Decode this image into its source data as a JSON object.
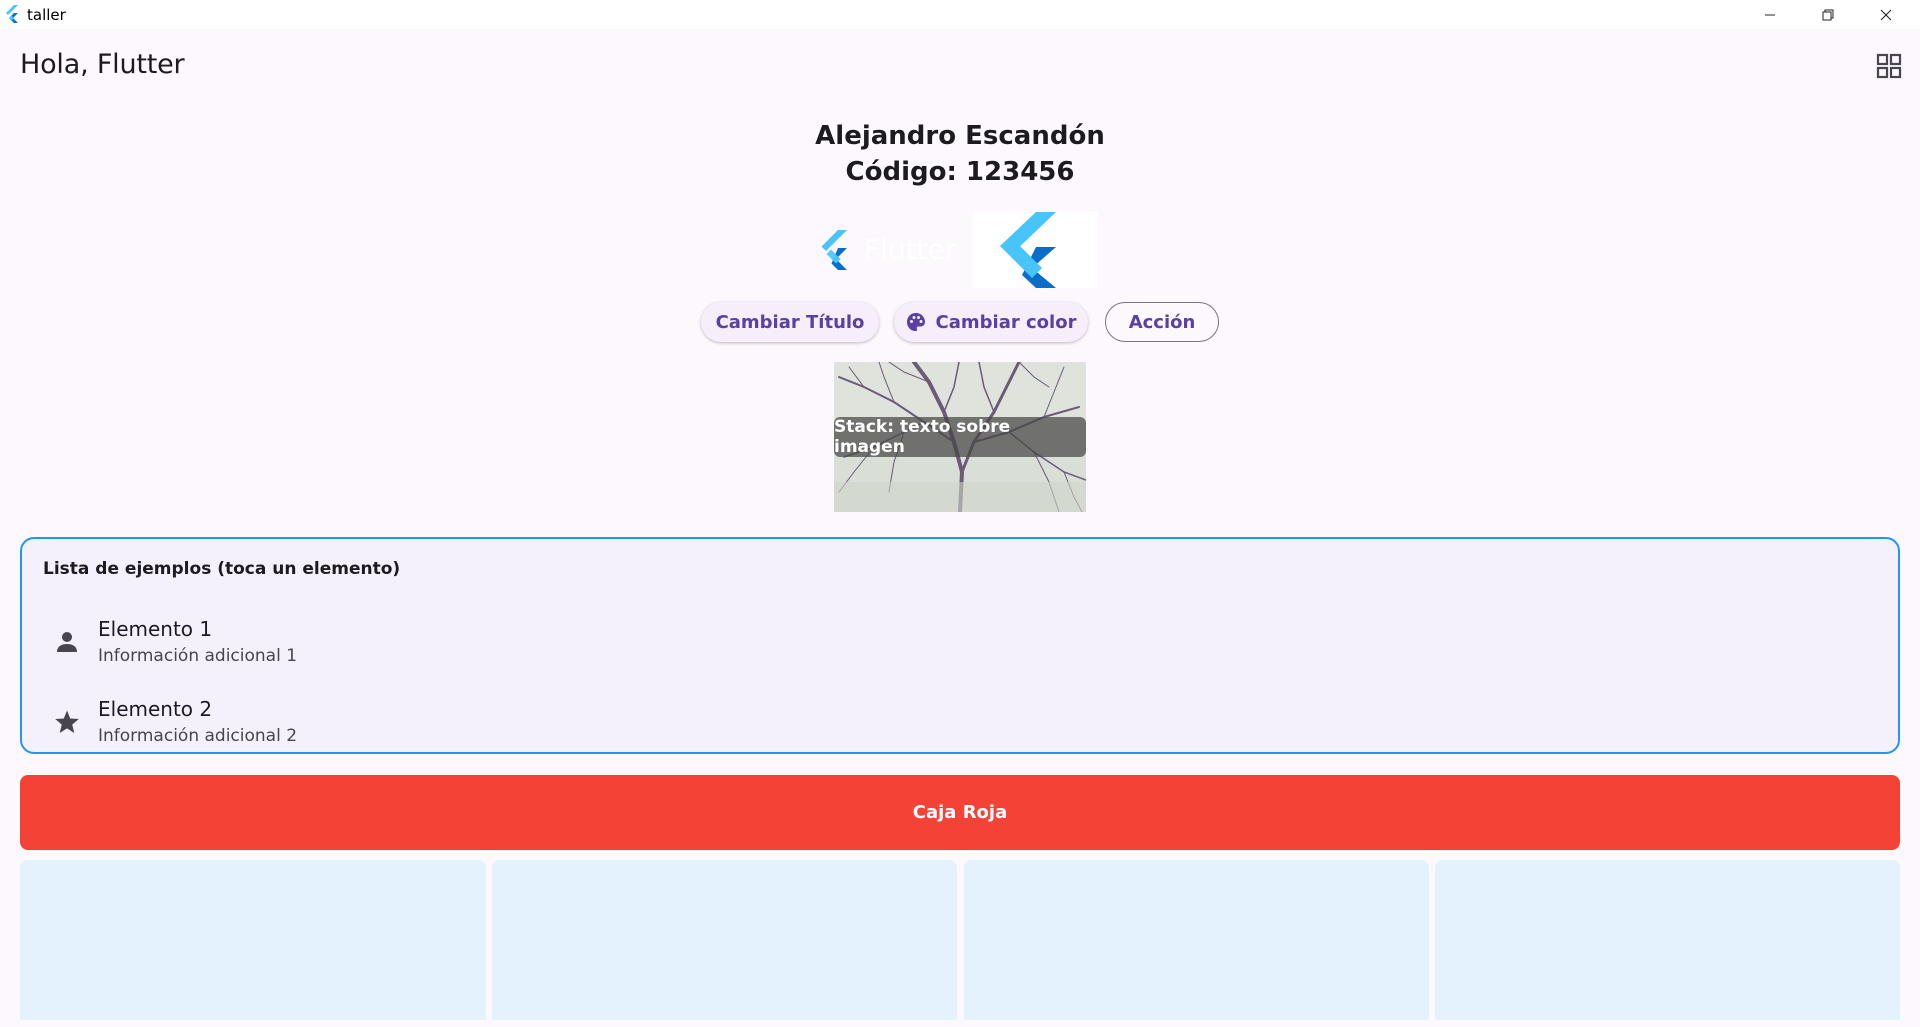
{
  "window": {
    "title": "taller"
  },
  "appbar": {
    "title": "Hola, Flutter",
    "action_icon": "grid-view-icon"
  },
  "header": {
    "name": "Alejandro Escandón",
    "code": "Código: 123456"
  },
  "logos": {
    "flutter_text": "Flutter"
  },
  "buttons": {
    "change_title": "Cambiar Título",
    "change_color": "Cambiar color",
    "action": "Acción"
  },
  "stack": {
    "overlay_text": "Stack: texto sobre imagen"
  },
  "list_card": {
    "title": "Lista de ejemplos (toca un elemento)",
    "items": [
      {
        "title": "Elemento 1",
        "subtitle": "Información adicional 1",
        "icon": "person-icon"
      },
      {
        "title": "Elemento 2",
        "subtitle": "Información adicional 2",
        "icon": "star-icon"
      }
    ]
  },
  "red_box": {
    "label": "Caja Roja"
  },
  "colors": {
    "background": "#fdf7fe",
    "primary_text": "#5a3fa5",
    "card_border": "#2196f3",
    "red_box": "#f44336",
    "tile": "#e3f2fd"
  }
}
